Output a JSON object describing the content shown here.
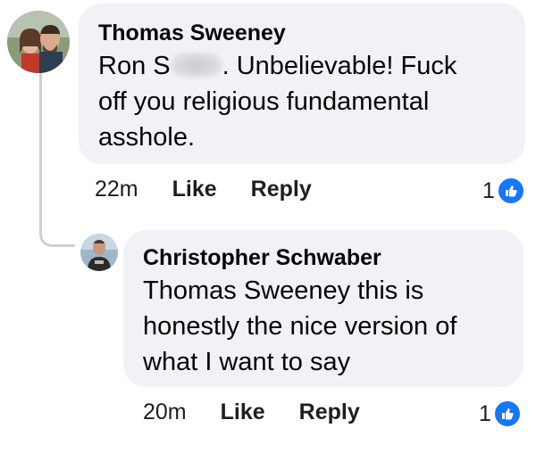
{
  "comments": [
    {
      "author": "Thomas Sweeney",
      "text_before_redaction": "Ron S",
      "text_after_redaction": ". Unbelievable! Fuck off you religious fundamental asshole.",
      "time": "22m",
      "like_label": "Like",
      "reply_label": "Reply",
      "reaction_count": "1",
      "reaction_icon": "thumbs-up-icon"
    },
    {
      "author": "Christopher Schwaber",
      "text": "Thomas Sweeney this is honestly the nice version of what I want to say",
      "time": "20m",
      "like_label": "Like",
      "reply_label": "Reply",
      "reaction_count": "1",
      "reaction_icon": "thumbs-up-icon"
    }
  ],
  "colors": {
    "bubble_bg": "#f0f2f5",
    "like_blue": "#1877f2",
    "thread_line": "#cdd0d5"
  }
}
